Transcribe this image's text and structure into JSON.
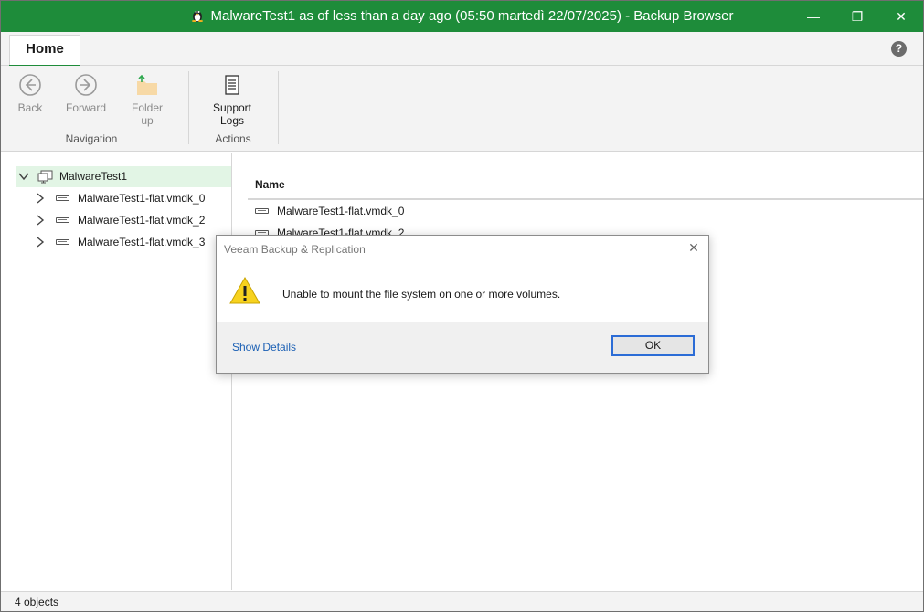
{
  "window": {
    "title": "MalwareTest1 as of less than a day ago (05:50 martedì 22/07/2025) - Backup Browser",
    "minimize": "—",
    "maximize": "❐",
    "close": "✕",
    "title_color": "#1e8c3a"
  },
  "ribbon": {
    "tab": "Home",
    "help": "?",
    "buttons": {
      "back": "Back",
      "forward": "Forward",
      "folder_up_1": "Folder",
      "folder_up_2": "up",
      "support_logs_1": "Support",
      "support_logs_2": "Logs"
    },
    "groups": {
      "navigation": "Navigation",
      "actions": "Actions"
    }
  },
  "tree": {
    "root": "MalwareTest1",
    "items": [
      "MalwareTest1-flat.vmdk_0",
      "MalwareTest1-flat.vmdk_2",
      "MalwareTest1-flat.vmdk_3"
    ]
  },
  "list": {
    "header": "Name",
    "rows": [
      "MalwareTest1-flat.vmdk_0",
      "MalwareTest1-flat.vmdk_2"
    ]
  },
  "status": {
    "text": "4 objects"
  },
  "dialog": {
    "title": "Veeam Backup & Replication",
    "message": "Unable to mount the file system on one or more volumes.",
    "show_details": "Show Details",
    "ok": "OK",
    "close": "✕"
  }
}
